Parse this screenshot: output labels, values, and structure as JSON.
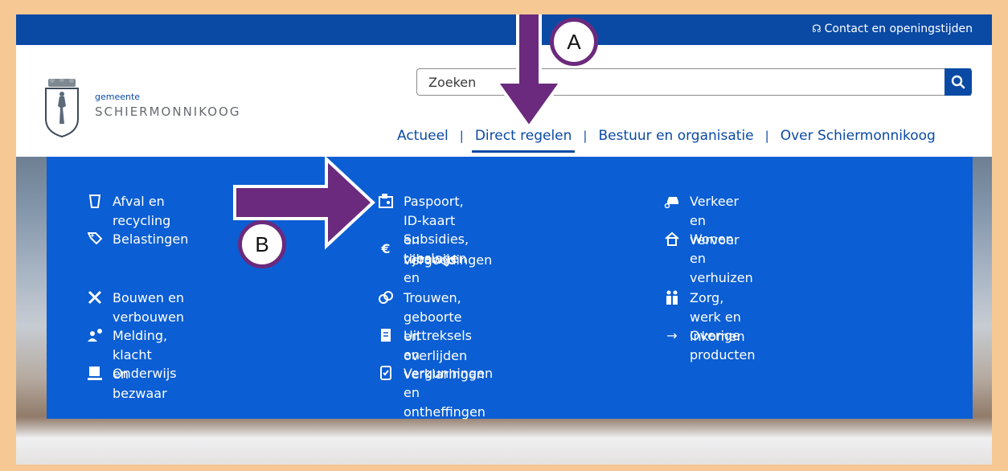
{
  "header": {
    "contact_label": "Contact en openingstijden",
    "logo_small": "gemeente",
    "logo_name": "SCHIERMONNIKOOG"
  },
  "search": {
    "placeholder": "Zoeken",
    "icon": "search-icon"
  },
  "nav": {
    "items": [
      "Actueel",
      "Direct regelen",
      "Bestuur en organisatie",
      "Over Schiermonnikoog"
    ],
    "active_index": 1
  },
  "menu": {
    "col1": [
      {
        "label": "Afval en recycling",
        "icon": "trash-icon"
      },
      {
        "label": "Belastingen",
        "icon": "tag-icon"
      },
      {
        "label": "Bouwen en verbouwen",
        "icon": "tools-icon"
      },
      {
        "label": "Melding, klacht en bezwaar",
        "icon": "person-alert-icon"
      },
      {
        "label": "Onderwijs",
        "icon": "school-icon"
      }
    ],
    "col2": [
      {
        "label": "Paspoort, ID-kaart en rijbewijs",
        "icon": "id-card-icon"
      },
      {
        "label": "Subsidies, toeslagen en",
        "label2": "vergoedingen",
        "icon": "euro-icon",
        "glyph": "€"
      },
      {
        "label": "Trouwen, geboorte en overlijden",
        "icon": "rings-icon"
      },
      {
        "label": "Uittreksels en verklaringen",
        "icon": "document-icon"
      },
      {
        "label": "Vergunningen en ontheffingen",
        "icon": "permit-icon"
      }
    ],
    "col3": [
      {
        "label": "Verkeer en vervoer",
        "icon": "car-icon"
      },
      {
        "label": "Wonen en verhuizen",
        "icon": "house-icon"
      },
      {
        "label": "Zorg, werk en inkomen",
        "icon": "people-icon"
      },
      {
        "label": "Overige producten",
        "icon": "arrow-right-icon",
        "glyph": "→"
      }
    ]
  },
  "annotations": {
    "a_label": "A",
    "b_label": "B",
    "arrow_color": "#6b2a7d"
  },
  "colors": {
    "brand_blue": "#0a4aa5",
    "menu_blue": "#0b5ed3",
    "frame_border": "#f6c893"
  }
}
